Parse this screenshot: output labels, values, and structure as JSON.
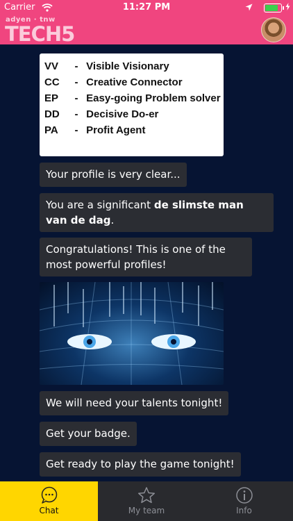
{
  "status_bar": {
    "carrier": "Carrier",
    "time": "11:27 PM"
  },
  "header": {
    "sponsors": "adyen · tnw",
    "title": "TECH5",
    "color": "#f0457f"
  },
  "profile_table": {
    "rows": [
      {
        "code": "VV",
        "dash": "-",
        "label": "Visible Visionary"
      },
      {
        "code": "CC",
        "dash": "-",
        "label": "Creative Connector"
      },
      {
        "code": "EP",
        "dash": "-",
        "label": "Easy-going Problem solver"
      },
      {
        "code": "DD",
        "dash": "-",
        "label": "Decisive Do-er"
      },
      {
        "code": "PA",
        "dash": "-",
        "label": "Profit Agent"
      }
    ]
  },
  "messages": {
    "m1": "Your profile is very clear...",
    "m2_prefix": "You are a significant ",
    "m2_bold": "de slimste man van de dag",
    "m2_suffix": ".",
    "m3": "Congratulations! This is one of the most powerful profiles!",
    "m4": "We will need your talents tonight!",
    "m5": "Get your badge.",
    "m6": "Get ready to play the game tonight!"
  },
  "tabs": {
    "chat": "Chat",
    "team": "My team",
    "info": "Info",
    "active": "Chat",
    "active_color": "#ffd600"
  },
  "icons": {
    "wifi": "wifi-icon",
    "location": "location-arrow-icon",
    "battery": "battery-icon",
    "charging": "charging-bolt-icon",
    "chat": "chat-bubble-icon",
    "team": "star-icon",
    "info": "info-icon"
  },
  "battery_level": 0.9
}
